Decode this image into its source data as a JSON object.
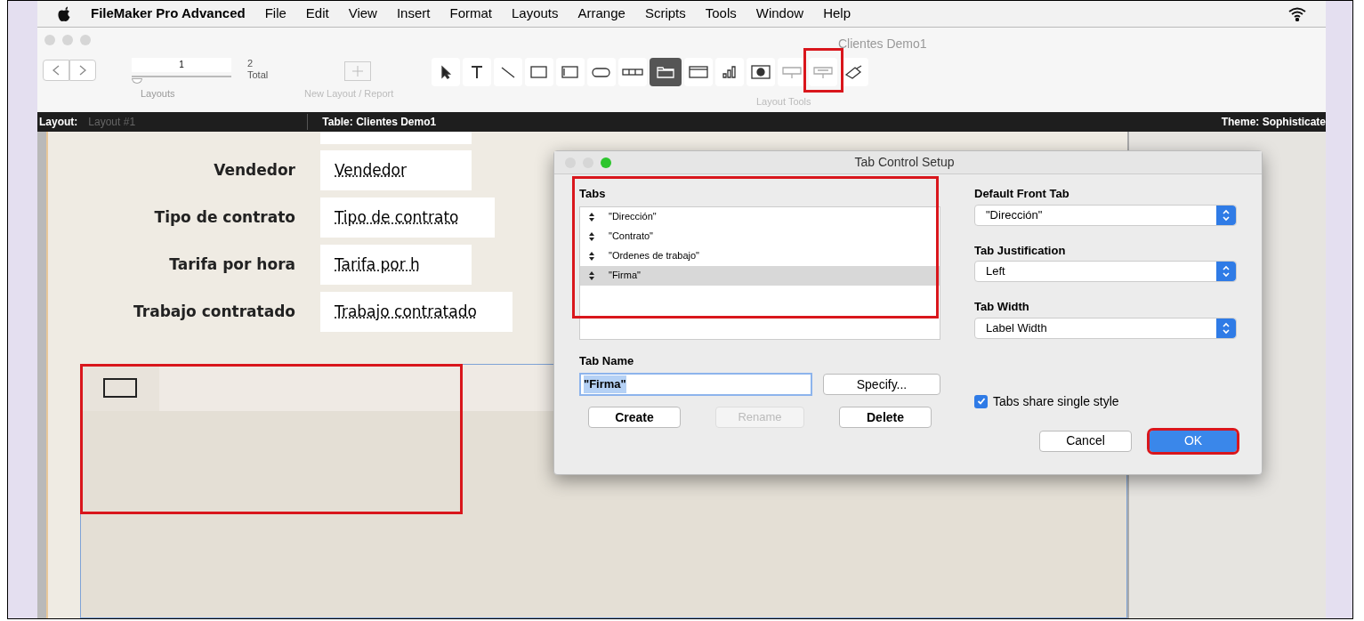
{
  "menu_bar": {
    "app_name": "FileMaker Pro Advanced",
    "items": [
      "File",
      "Edit",
      "View",
      "Insert",
      "Format",
      "Layouts",
      "Arrange",
      "Scripts",
      "Tools",
      "Window",
      "Help"
    ]
  },
  "toolbar": {
    "window_title": "Clientes Demo1",
    "record": "1",
    "record_slider": {
      "level": 0
    },
    "total": "2",
    "total_label": "Total",
    "layouts_label": "Layouts",
    "new_layout_label": "New Layout / Report",
    "tools_label": "Layout Tools",
    "tools": [
      {
        "kind": "pointer",
        "selected": false
      },
      {
        "kind": "text",
        "selected": false
      },
      {
        "kind": "line",
        "selected": false
      },
      {
        "kind": "rectangle",
        "selected": false
      },
      {
        "kind": "field",
        "selected": false
      },
      {
        "kind": "button",
        "selected": false
      },
      {
        "kind": "button-bar",
        "selected": false
      },
      {
        "kind": "tab-control",
        "selected": true
      },
      {
        "kind": "slide-control",
        "selected": false
      },
      {
        "kind": "chart",
        "selected": false
      },
      {
        "kind": "web-viewer",
        "selected": false
      },
      {
        "kind": "popover",
        "selected": false
      },
      {
        "kind": "popover-button",
        "selected": false
      },
      {
        "kind": "painter",
        "selected": false
      }
    ]
  },
  "layout_bar": {
    "layout_label": "Layout:",
    "layout_value": "Layout #1",
    "table": "Table: Clientes Demo1",
    "theme": "Theme: Sophisticate"
  },
  "fields": [
    {
      "label": "Vendedor",
      "value": "Vendedor"
    },
    {
      "label": "Tipo de contrato",
      "value": "Tipo de contrato"
    },
    {
      "label": "Tarifa por hora",
      "value": "Tarifa por h"
    },
    {
      "label": "Trabajo contratado",
      "value": "Trabajo contratado"
    }
  ],
  "dialog": {
    "title": "Tab Control Setup",
    "tabs_label": "Tabs",
    "tabs": [
      {
        "label": "\"Dirección\"",
        "selected": false
      },
      {
        "label": "\"Contrato\"",
        "selected": false
      },
      {
        "label": "\"Ordenes de trabajo\"",
        "selected": false
      },
      {
        "label": "\"Firma\"",
        "selected": true
      }
    ],
    "tab_name_label": "Tab Name",
    "tab_name_value": "\"Firma\"",
    "specify": "Specify...",
    "actions": [
      {
        "label": "Create",
        "disabled": false
      },
      {
        "label": "Rename",
        "disabled": true
      },
      {
        "label": "Delete",
        "disabled": false
      }
    ],
    "selects": [
      {
        "label": "Default Front Tab",
        "value": "\"Dirección\""
      },
      {
        "label": "Tab Justification",
        "value": "Left"
      },
      {
        "label": "Tab Width",
        "value": "Label Width"
      }
    ],
    "share_style": {
      "label": "Tabs share single style",
      "checked": true
    },
    "cancel": "Cancel",
    "ok": "OK"
  }
}
